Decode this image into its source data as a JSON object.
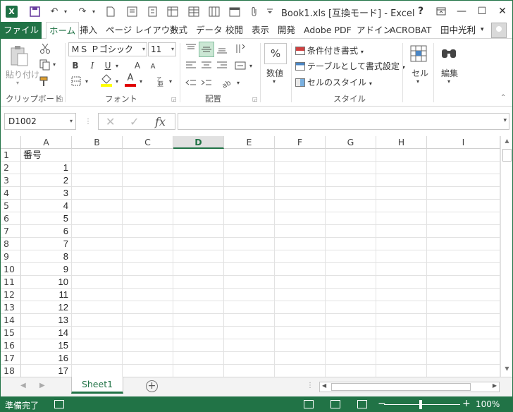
{
  "window": {
    "title": "Book1.xls  [互換モード] - Excel",
    "help_glyph": "?",
    "restore_glyph": "⧉",
    "minimize_glyph": "—",
    "maximize_glyph": "☐",
    "close_glyph": "✕"
  },
  "qat": {
    "app_logo": "X",
    "undo_glyph": "↶",
    "redo_glyph": "↷"
  },
  "tabs": {
    "file": "ファイル",
    "home": "ホーム",
    "insert": "挿入",
    "page_layout": "ページ レイアウト",
    "formulas": "数式",
    "data": "データ",
    "review": "校閲",
    "view": "表示",
    "developer": "開発",
    "adobe_pdf": "Adobe PDF",
    "addins": "アドイン",
    "acrobat": "ACROBAT",
    "user": "田中光利",
    "user_arrow": "▾"
  },
  "ribbon": {
    "paste_label": "貼り付け",
    "clipboard_group": "クリップボード",
    "font_name": "ＭＳ Ｐゴシック",
    "font_size": "11",
    "bold": "B",
    "italic": "I",
    "underline": "U",
    "grow_font": "A",
    "shrink_font": "A",
    "font_color_glyph": "A",
    "font_group": "フォント",
    "alignment_group": "配置",
    "number_percent": "%",
    "number_label": "数値",
    "conditional_format": "条件付き書式",
    "format_as_table": "テーブルとして書式設定",
    "cell_styles": "セルのスタイル",
    "styles_group": "スタイル",
    "cells_label": "セル",
    "editing_label": "編集",
    "dropdown_glyph": "▾"
  },
  "formula_bar": {
    "name_box": "D1002",
    "cancel_glyph": "✕",
    "enter_glyph": "✓",
    "fx": "fx",
    "value": ""
  },
  "sheet": {
    "columns": [
      "A",
      "B",
      "C",
      "D",
      "E",
      "F",
      "G",
      "H",
      "I"
    ],
    "selected_column": "D",
    "rows": [
      "1",
      "2",
      "3",
      "4",
      "5",
      "6",
      "7",
      "8",
      "9",
      "10",
      "11",
      "12",
      "13",
      "14",
      "15",
      "16",
      "17",
      "18"
    ],
    "a_header": "番号",
    "a_values": [
      "1",
      "2",
      "3",
      "4",
      "5",
      "6",
      "7",
      "8",
      "9",
      "10",
      "11",
      "12",
      "13",
      "14",
      "15",
      "16",
      "17"
    ]
  },
  "sheet_tabs": {
    "active": "Sheet1",
    "add_glyph": "+",
    "nav_prev": "◀",
    "nav_next": "▶"
  },
  "status": {
    "ready": "準備完了",
    "zoom": "100%",
    "zoom_minus": "−",
    "zoom_plus": "+"
  },
  "colors": {
    "accent": "#217346",
    "grid_line": "#e2e2e2"
  }
}
